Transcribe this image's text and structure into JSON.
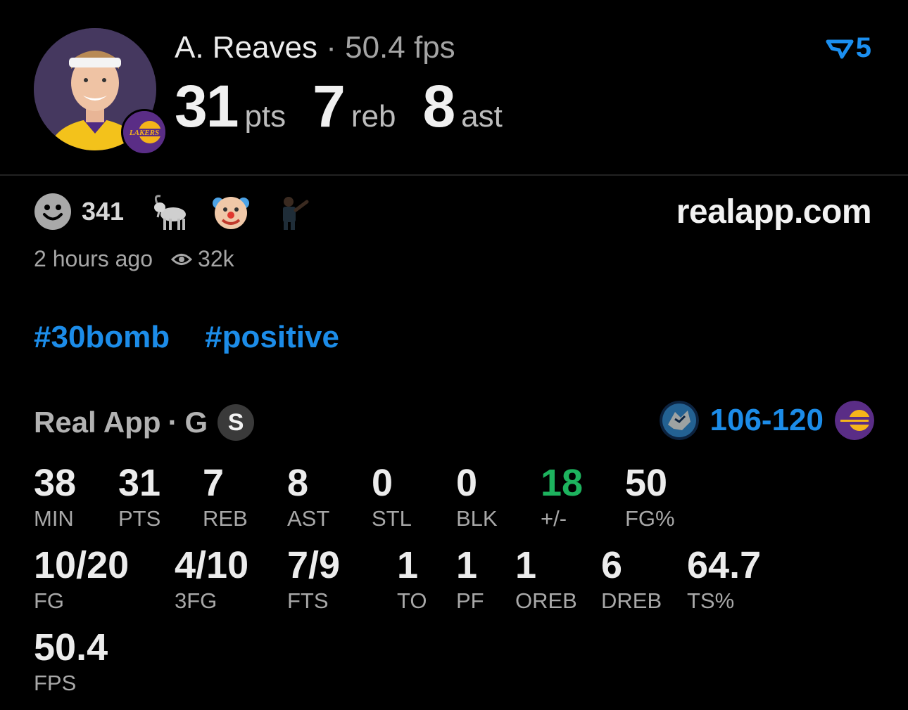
{
  "header": {
    "player_name": "A. Reaves",
    "separator": "·",
    "fps_text": "50.4 fps",
    "points": "31",
    "points_unit": "pts",
    "rebounds": "7",
    "rebounds_unit": "reb",
    "assists": "8",
    "assists_unit": "ast",
    "vote_count": "5",
    "team_badge_text": "LAKERS"
  },
  "reactions": {
    "count": "341",
    "items": [
      "goat-emoji",
      "clown-emoji",
      "player-sticker"
    ]
  },
  "site": "realapp.com",
  "meta": {
    "time": "2 hours ago",
    "views": "32k"
  },
  "tags": [
    "#30bomb",
    "#positive"
  ],
  "game": {
    "source": "Real App",
    "separator": "·",
    "position": "G",
    "badge": "S",
    "away_score": "106",
    "dash": "-",
    "home_score": "120",
    "away_team": "Timberwolves",
    "home_team": "Lakers"
  },
  "stats_row1": [
    {
      "value": "38",
      "label": "MIN"
    },
    {
      "value": "31",
      "label": "PTS"
    },
    {
      "value": "7",
      "label": "REB"
    },
    {
      "value": "8",
      "label": "AST"
    },
    {
      "value": "0",
      "label": "STL"
    },
    {
      "value": "0",
      "label": "BLK"
    },
    {
      "value": "18",
      "label": "+/-"
    },
    {
      "value": "50",
      "label": "FG%"
    }
  ],
  "stats_row2": [
    {
      "value": "10/20",
      "label": "FG"
    },
    {
      "value": "4/10",
      "label": "3FG"
    },
    {
      "value": "7/9",
      "label": "FTS"
    },
    {
      "value": "1",
      "label": "TO"
    },
    {
      "value": "1",
      "label": "PF"
    },
    {
      "value": "1",
      "label": "OREB"
    },
    {
      "value": "6",
      "label": "DREB"
    },
    {
      "value": "64.7",
      "label": "TS%"
    }
  ],
  "stats_row3": [
    {
      "value": "50.4",
      "label": "FPS"
    }
  ],
  "colors": {
    "accent": "#1c8ce8",
    "positive": "#1db35e",
    "lakers_purple": "#4f2a83",
    "lakers_gold": "#f5b41a"
  }
}
